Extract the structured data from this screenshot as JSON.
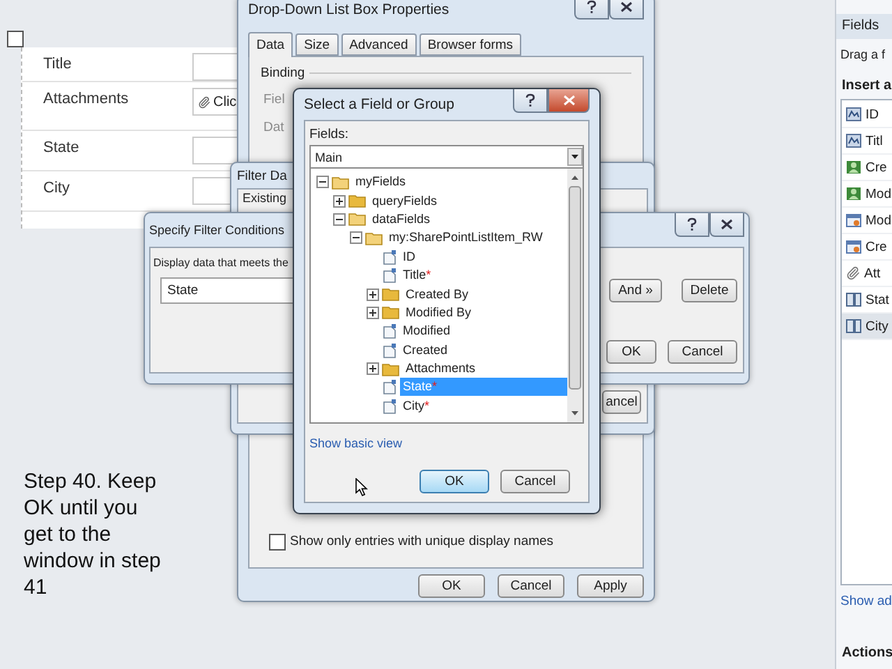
{
  "form": {
    "checkbox": {
      "checked": false
    },
    "rows": [
      {
        "label": "Title",
        "value": ""
      },
      {
        "label": "Attachments",
        "value": "Clic"
      },
      {
        "label": "State",
        "value": ""
      },
      {
        "label": "City",
        "value": ""
      }
    ]
  },
  "step_note": [
    "Step 40. Keep",
    "OK until you",
    "get to the",
    "window in step",
    "41"
  ],
  "fields_pane": {
    "title": "Fields",
    "hint": "Drag a f",
    "section": "Insert a",
    "items": [
      {
        "label": "ID",
        "kind": "text",
        "selected": false
      },
      {
        "label": "Titl",
        "kind": "text",
        "selected": false
      },
      {
        "label": "Cre",
        "kind": "person",
        "selected": false
      },
      {
        "label": "Mod",
        "kind": "person",
        "selected": false
      },
      {
        "label": "Mod",
        "kind": "date",
        "selected": false
      },
      {
        "label": "Cre",
        "kind": "date",
        "selected": false
      },
      {
        "label": "Att",
        "kind": "attachment",
        "selected": false
      },
      {
        "label": "Stat",
        "kind": "column",
        "selected": false
      },
      {
        "label": "City",
        "kind": "column",
        "selected": true
      }
    ],
    "link": "Show ad",
    "actions_title": "Actions"
  },
  "properties_dialog": {
    "title": "Drop-Down List Box Properties",
    "tabs": [
      {
        "label": "Data",
        "selected": true
      },
      {
        "label": "Size",
        "selected": false
      },
      {
        "label": "Advanced",
        "selected": false
      },
      {
        "label": "Browser forms",
        "selected": false
      }
    ],
    "binding": "Binding",
    "field_label": "Fiel",
    "data_label": "Dat",
    "unique_checkbox": {
      "label": "Show only entries with unique display names",
      "checked": false
    },
    "buttons": [
      "OK",
      "Cancel",
      "Apply"
    ]
  },
  "filter_data_dialog": {
    "title": "Filter Da",
    "existing": "Existing",
    "button": "ancel"
  },
  "filter_conditions_dialog": {
    "title": "Specify Filter Conditions",
    "prompt": "Display data that meets the",
    "field": "State",
    "buttons": [
      "And »",
      "Delete",
      "OK",
      "Cancel"
    ]
  },
  "select_field_dialog": {
    "title": "Select a Field or Group",
    "fields_label": "Fields:",
    "source": "Main",
    "tree": [
      {
        "name": "myFields",
        "kind": "group",
        "expanded": true,
        "selected": false,
        "children": [
          {
            "name": "queryFields",
            "kind": "group",
            "expanded": false,
            "selected": false
          },
          {
            "name": "dataFields",
            "kind": "group",
            "expanded": true,
            "selected": false,
            "children": [
              {
                "name": "my:SharePointListItem_RW",
                "kind": "group",
                "expanded": true,
                "selected": false,
                "children": [
                  {
                    "name": "ID",
                    "kind": "field",
                    "selected": false
                  },
                  {
                    "name": "Title",
                    "kind": "field",
                    "mark": "*",
                    "selected": false
                  },
                  {
                    "name": "Created By",
                    "kind": "group",
                    "expanded": false,
                    "selected": false
                  },
                  {
                    "name": "Modified By",
                    "kind": "group",
                    "expanded": false,
                    "selected": false
                  },
                  {
                    "name": "Modified",
                    "kind": "field",
                    "selected": false
                  },
                  {
                    "name": "Created",
                    "kind": "field",
                    "selected": false
                  },
                  {
                    "name": "Attachments",
                    "kind": "group",
                    "expanded": false,
                    "selected": false
                  },
                  {
                    "name": "State",
                    "kind": "field",
                    "mark": "*",
                    "selected": true
                  },
                  {
                    "name": "City",
                    "kind": "field",
                    "mark": "*",
                    "selected": false
                  }
                ]
              }
            ]
          }
        ]
      }
    ],
    "link": "Show basic view",
    "buttons": [
      "OK",
      "Cancel"
    ]
  }
}
